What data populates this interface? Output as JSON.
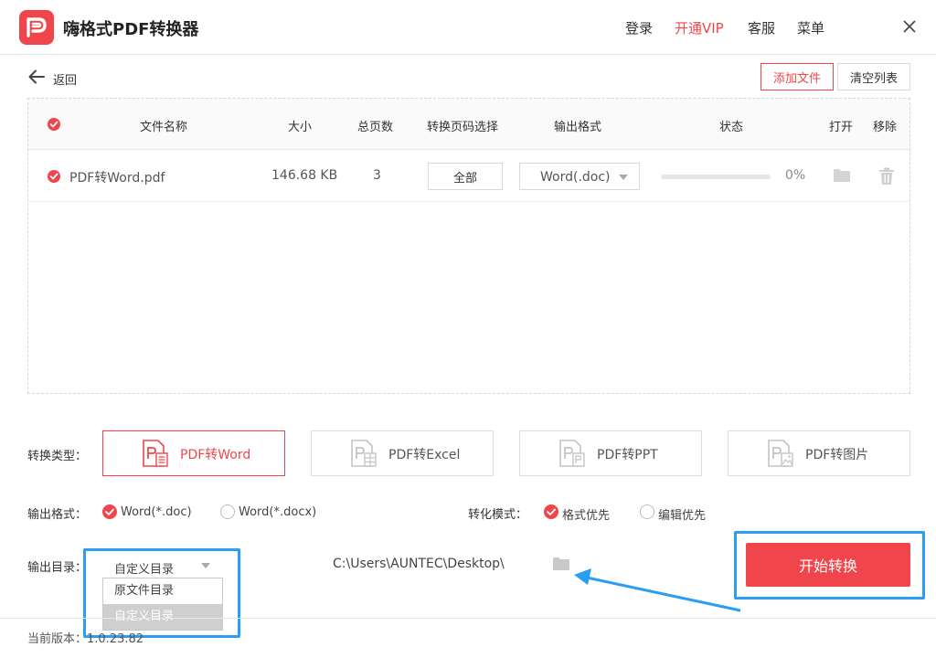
{
  "app": {
    "title": "嗨格式PDF转换器"
  },
  "top_menu": {
    "login": "登录",
    "vip": "开通VIP",
    "service": "客服",
    "menu": "菜单"
  },
  "toolbar": {
    "back_label": "返回",
    "add_file": "添加文件",
    "clear_list": "清空列表"
  },
  "table": {
    "headers": {
      "name": "文件名称",
      "size": "大小",
      "pages": "总页数",
      "page_select": "转换页码选择",
      "output_format": "输出格式",
      "status": "状态",
      "open": "打开",
      "remove": "移除"
    },
    "rows": [
      {
        "name": "PDF转Word.pdf",
        "size": "146.68 KB",
        "pages": "3",
        "page_select": "全部",
        "format": "Word(.doc)",
        "progress_text": "0%",
        "progress_fraction": 0
      }
    ]
  },
  "conversion": {
    "type_label": "转换类型：",
    "types": [
      {
        "label": "PDF转Word",
        "active": true
      },
      {
        "label": "PDF转Excel",
        "active": false
      },
      {
        "label": "PDF转PPT",
        "active": false
      },
      {
        "label": "PDF转图片",
        "active": false
      }
    ],
    "format_label": "输出格式：",
    "formats": [
      {
        "label": "Word(*.doc)",
        "checked": true
      },
      {
        "label": "Word(*.docx)",
        "checked": false
      }
    ],
    "mode_label": "转化模式：",
    "modes": [
      {
        "label": "格式优先",
        "checked": true
      },
      {
        "label": "编辑优先",
        "checked": false
      }
    ],
    "output_dir_label": "输出目录：",
    "output_dir_selected": "自定义目录",
    "output_dir_options": [
      "原文件目录",
      "自定义目录"
    ],
    "output_path": "C:\\Users\\AUNTEC\\Desktop\\",
    "start_button": "开始转换"
  },
  "footer": {
    "version": "当前版本：1.0.23.82"
  },
  "colors": {
    "accent": "#f0464b",
    "highlight": "#2a9df4"
  }
}
